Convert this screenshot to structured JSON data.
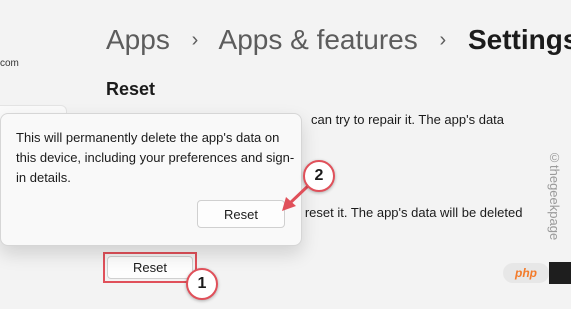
{
  "left_panel": {
    "partial_text": "com"
  },
  "breadcrumb": {
    "items": [
      "Apps",
      "Apps & features"
    ],
    "separator": "›",
    "current": "Settings"
  },
  "section": {
    "title": "Reset",
    "repair_text_partial": "can try to repair it. The app's data",
    "reset_text_partial": "t, reset it. The app's data will be deleted",
    "reset_button_label": "Reset"
  },
  "popup": {
    "message": "This will permanently delete the app's data on this device, including your preferences and sign-in details.",
    "confirm_button_label": "Reset"
  },
  "annotations": {
    "step1_label": "1",
    "step2_label": "2",
    "highlight_color": "#e0505a",
    "arrow_color": "#e0505a"
  },
  "watermark": {
    "text": "©thegeekpage"
  },
  "logo": {
    "text": "php"
  },
  "colors": {
    "background": "#f3f3f3",
    "accent": "#e0505a"
  }
}
